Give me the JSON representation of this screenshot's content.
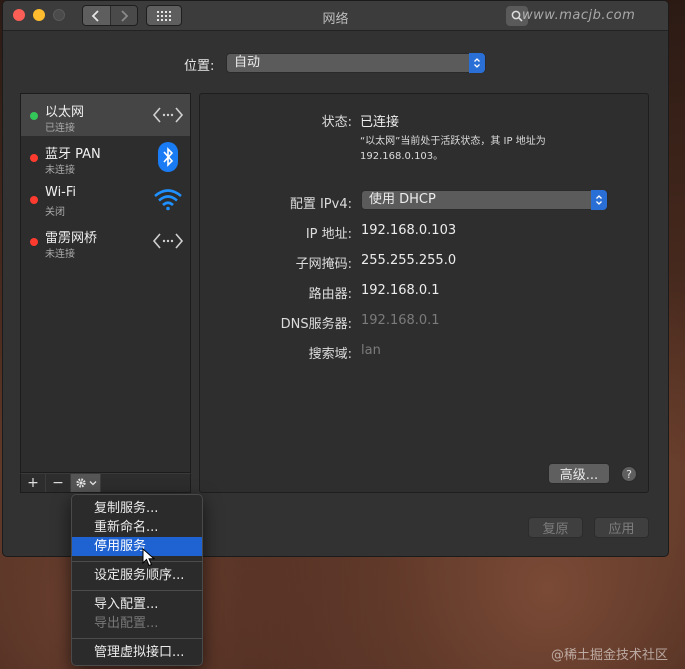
{
  "window": {
    "title": "网络"
  },
  "watermarks": {
    "top": "www.macjb.com",
    "bottom": "@稀土掘金技术社区"
  },
  "location": {
    "label": "位置:",
    "value": "自动"
  },
  "services": [
    {
      "name": "以太网",
      "status": "已连接",
      "status_color": "#34c759",
      "icon": "ethernet-icon",
      "selected": true
    },
    {
      "name": "蓝牙 PAN",
      "status": "未连接",
      "status_color": "#ff3b30",
      "icon": "bluetooth-icon",
      "selected": false
    },
    {
      "name": "Wi-Fi",
      "status": "关闭",
      "status_color": "#ff3b30",
      "icon": "wifi-icon",
      "selected": false
    },
    {
      "name": "雷雳网桥",
      "status": "未连接",
      "status_color": "#ff3b30",
      "icon": "thunderbolt-bridge-icon",
      "selected": false
    }
  ],
  "sidebar_toolbar": {
    "add": "+",
    "remove": "−",
    "gear": "⚙︎"
  },
  "detail": {
    "status_label": "状态:",
    "status_value": "已连接",
    "status_desc": "“以太网”当前处于活跃状态，其 IP 地址为 192.168.0.103。",
    "ipv4_label": "配置 IPv4:",
    "ipv4_value": "使用 DHCP",
    "ip_label": "IP 地址:",
    "ip_value": "192.168.0.103",
    "subnet_label": "子网掩码:",
    "subnet_value": "255.255.255.0",
    "router_label": "路由器:",
    "router_value": "192.168.0.1",
    "dns_label": "DNS服务器:",
    "dns_value": "192.168.0.1",
    "search_label": "搜索域:",
    "search_value": "lan"
  },
  "buttons": {
    "advanced": "高级...",
    "help": "?",
    "revert": "复原",
    "apply": "应用"
  },
  "menu": [
    {
      "label": "复制服务...",
      "state": "normal"
    },
    {
      "label": "重新命名...",
      "state": "normal"
    },
    {
      "label": "停用服务",
      "state": "highlighted"
    },
    {
      "separator": true
    },
    {
      "label": "设定服务顺序...",
      "state": "normal"
    },
    {
      "separator": true
    },
    {
      "label": "导入配置...",
      "state": "normal"
    },
    {
      "label": "导出配置...",
      "state": "disabled"
    },
    {
      "separator": true
    },
    {
      "label": "管理虚拟接口...",
      "state": "normal"
    }
  ],
  "colors": {
    "accent": "#1f62d1",
    "connected": "#34c759",
    "disconnected": "#ff3b30",
    "wifi": "#1e90ff",
    "bluetooth": "#1a7cf5"
  }
}
